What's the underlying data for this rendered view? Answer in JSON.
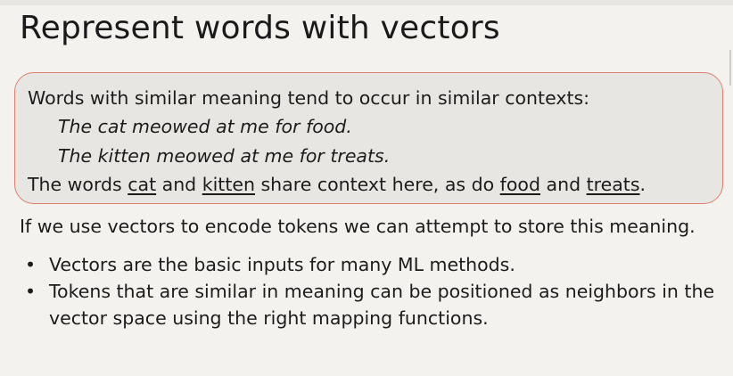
{
  "slide": {
    "title": "Represent words with vectors"
  },
  "callout": {
    "intro": "Words with similar meaning tend to occur in similar contexts:",
    "example_1": "The cat meowed at me for food.",
    "example_2": "The kitten meowed at me for treats.",
    "conclusion": {
      "part_1": "The words ",
      "word_1": "cat",
      "part_2": " and ",
      "word_2": "kitten",
      "part_3": " share context here, as do ",
      "word_3": "food",
      "part_4": " and ",
      "word_4": "treats",
      "part_5": "."
    }
  },
  "body": {
    "paragraph": "If we use vectors to encode tokens we can attempt to store this meaning."
  },
  "bullets": [
    {
      "marker": "•",
      "text": "Vectors are the basic inputs for many ML methods."
    },
    {
      "marker": "•",
      "text": "Tokens that are similar in meaning can be positioned as neighbors in the vector space using the right mapping functions."
    }
  ]
}
